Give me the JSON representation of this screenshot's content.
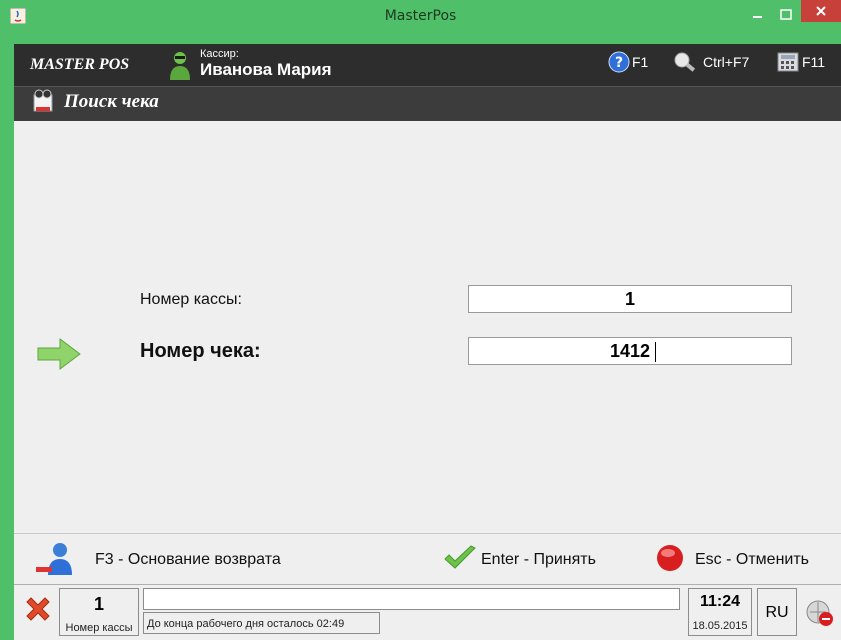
{
  "window": {
    "title": "MasterPos",
    "colors": {
      "frame": "#4fbf6a",
      "header": "#2d2d2d",
      "content": "#efefef",
      "close": "#c7403a"
    }
  },
  "header": {
    "brand": "MASTER POS",
    "cashier_label": "Кассир:",
    "cashier_name": "Иванова Мария",
    "hotkeys": [
      {
        "icon": "help-icon",
        "label": "F1"
      },
      {
        "icon": "search-icon",
        "label": "Ctrl+F7"
      },
      {
        "icon": "calculator-icon",
        "label": "F11"
      }
    ]
  },
  "subheader": {
    "title": "Поиск чека",
    "icon": "receipt-search-icon"
  },
  "form": {
    "kassa_label": "Номер кассы:",
    "kassa_value": "1",
    "check_label": "Номер чека:",
    "check_value": "1412"
  },
  "actions": {
    "f3": "F3 - Основание возврата",
    "enter": "Enter - Принять",
    "esc": "Esc - Отменить"
  },
  "status": {
    "kassa_number": "1",
    "kassa_caption": "Номер кассы",
    "message": "До конца рабочего дня осталось 02:49",
    "time": "11:24",
    "date": "18.05.2015",
    "lang": "RU"
  }
}
